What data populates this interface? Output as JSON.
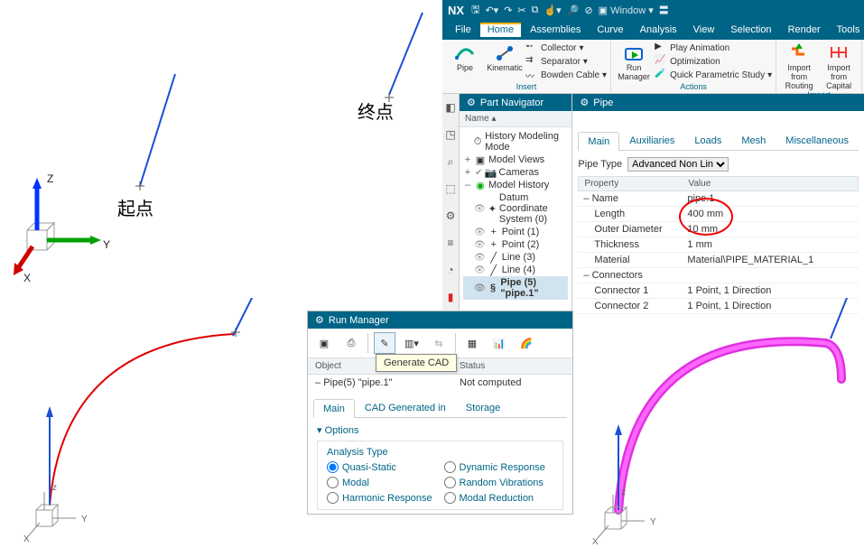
{
  "labels": {
    "起点": "起点",
    "终点": "终点"
  },
  "nx": {
    "logo": "NX",
    "window_menu": "Window",
    "menu": {
      "file": "File",
      "home": "Home",
      "assemblies": "Assemblies",
      "curve": "Curve",
      "analysis": "Analysis",
      "view": "View",
      "selection": "Selection",
      "render": "Render",
      "tools": "Tools"
    },
    "ribbon": {
      "insert": {
        "label": "Insert",
        "pipe": "Pipe",
        "kinematic": "Kinematic",
        "collector": "Collector",
        "separator": "Separator",
        "bowden": "Bowden Cable"
      },
      "run_manager": "Run\nManager",
      "actions": {
        "label": "Actions",
        "play": "Play Animation",
        "opt": "Optimization",
        "qps": "Quick Parametric Study"
      },
      "import": {
        "label": "Import",
        "routing": "Import from\nRouting",
        "capital": "Import\nfrom Capital"
      }
    }
  },
  "partnav": {
    "title": "Part Navigator",
    "col_name": "Name",
    "items": {
      "history": "History Modeling Mode",
      "model_views": "Model Views",
      "cameras": "Cameras",
      "model_history": "Model History",
      "datum": "Datum Coordinate System (0)",
      "point1": "Point (1)",
      "point2": "Point (2)",
      "line3": "Line (3)",
      "line4": "Line (4)",
      "pipe5": "Pipe (5) \"pipe.1\""
    }
  },
  "pipe": {
    "title": "Pipe",
    "tabs": {
      "main": "Main",
      "aux": "Auxiliaries",
      "loads": "Loads",
      "mesh": "Mesh",
      "misc": "Miscellaneous"
    },
    "type_label": "Pipe Type",
    "type_value": "Advanced Non Lin",
    "cols": {
      "prop": "Property",
      "val": "Value"
    },
    "rows": {
      "name_k": "Name",
      "name_v": "pipe.1",
      "len_k": "Length",
      "len_v": "400 mm",
      "od_k": "Outer Diameter",
      "od_v": "10 mm",
      "th_k": "Thickness",
      "th_v": "1 mm",
      "mat_k": "Material",
      "mat_v": "Material\\PIPE_MATERIAL_1",
      "conn_k": "Connectors",
      "c1_k": "Connector 1",
      "c1_v": "1 Point, 1 Direction",
      "c2_k": "Connector 2",
      "c2_v": "1 Point, 1 Direction"
    }
  },
  "runmgr": {
    "title": "Run Manager",
    "tooltip": "Generate CAD",
    "cols": {
      "obj": "Object",
      "status": "Status"
    },
    "row": {
      "obj": "Pipe(5) \"pipe.1\"",
      "status": "Not computed"
    },
    "tabs": {
      "main": "Main",
      "cad": "CAD Generated in",
      "storage": "Storage"
    },
    "options_label": "Options",
    "analysis_label": "Analysis Type",
    "opts": {
      "qs": "Quasi-Static",
      "dr": "Dynamic Response",
      "modal": "Modal",
      "rv": "Random Vibrations",
      "hr": "Harmonic Response",
      "mr": "Modal Reduction"
    }
  },
  "axes": {
    "x": "X",
    "y": "Y",
    "z": "Z"
  }
}
